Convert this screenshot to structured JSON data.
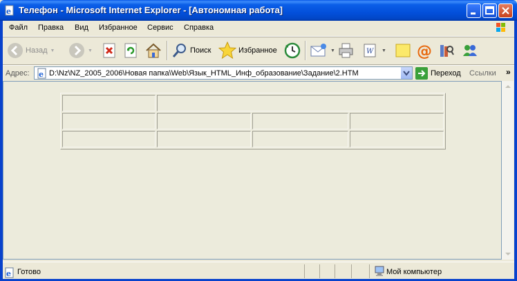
{
  "window": {
    "title": "Телефон - Microsoft Internet Explorer - [Автономная работа]"
  },
  "menu": {
    "items": [
      "Файл",
      "Правка",
      "Вид",
      "Избранное",
      "Сервис",
      "Справка"
    ]
  },
  "toolbar": {
    "back_label": "Назад",
    "search_label": "Поиск",
    "favorites_label": "Избранное"
  },
  "address": {
    "label": "Адрес:",
    "url": "D:\\Nz\\NZ_2005_2006\\Новая папка\\Web\\Язык_HTML_Инф_образование\\Задание\\2.HTM",
    "go_label": "Переход",
    "links_label": "Ссылки"
  },
  "status": {
    "text": "Готово",
    "zone": "Мой компьютер"
  },
  "colors": {
    "titlebar": "#0054e3",
    "chrome": "#ece9d8",
    "page_bg": "#ecebdc"
  }
}
